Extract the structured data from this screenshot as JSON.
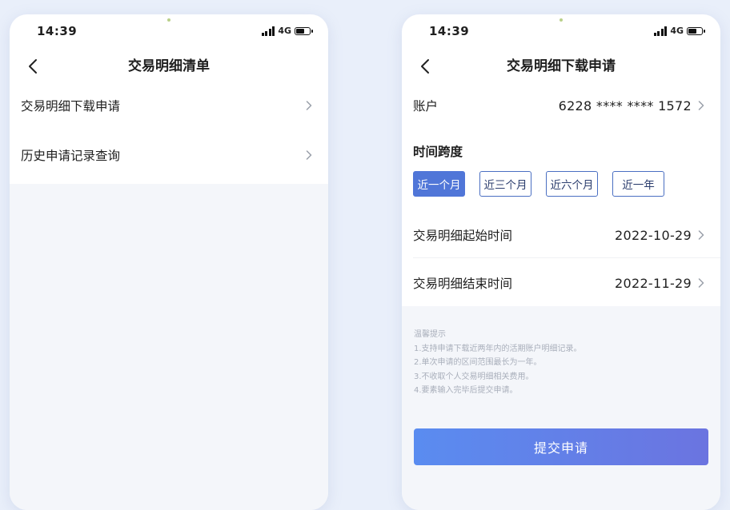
{
  "left_screen": {
    "status_bar": {
      "time": "14:39",
      "network": "4G"
    },
    "nav": {
      "title": "交易明细清单"
    },
    "menu": [
      {
        "label": "交易明细下载申请"
      },
      {
        "label": "历史申请记录查询"
      }
    ]
  },
  "right_screen": {
    "status_bar": {
      "time": "14:39",
      "network": "4G"
    },
    "nav": {
      "title": "交易明细下载申请"
    },
    "account": {
      "label": "账户",
      "value": "6228 **** **** 1572"
    },
    "time_span": {
      "title": "时间跨度",
      "options": [
        "近一个月",
        "近三个月",
        "近六个月",
        "近一年"
      ],
      "selected": "近一个月"
    },
    "start_date": {
      "label": "交易明细起始时间",
      "value": "2022-10-29"
    },
    "end_date": {
      "label": "交易明细结束时间",
      "value": "2022-11-29"
    },
    "tips": {
      "title": "温馨提示",
      "lines": [
        "1.支持申请下载近两年内的活期账户明细记录。",
        "2.单次申请的区间范围最长为一年。",
        "3.不收取个人交易明细相关费用。",
        "4.要素输入完毕后提交申请。"
      ]
    },
    "submit_label": "提交申请"
  },
  "colors": {
    "accent": "#5076d8",
    "page_background": "#e9effa",
    "submit_gradient_start": "#5a8cf0",
    "submit_gradient_end": "#6b74e0",
    "tips_text": "#a9afbb"
  }
}
